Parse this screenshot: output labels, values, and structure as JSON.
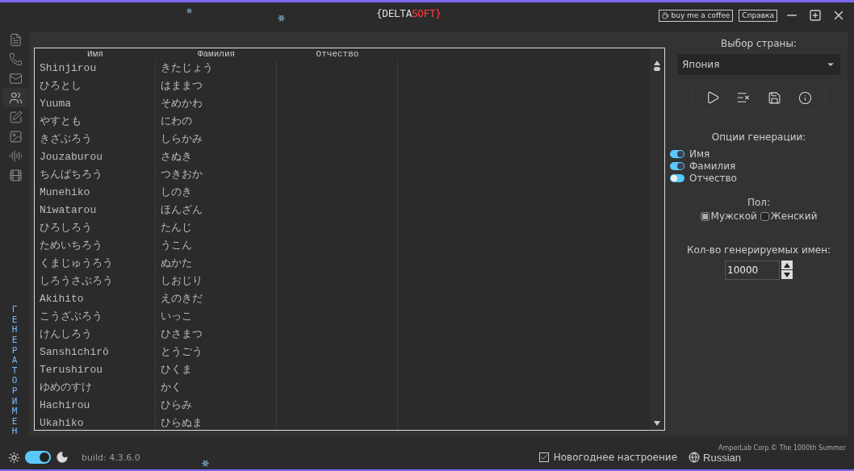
{
  "title_bar": {
    "logo": {
      "left": "{DELTA",
      "right": "SOFT}"
    },
    "buttons": [
      "buy me a coffee",
      "Справка"
    ]
  },
  "sidebar": {
    "items": [
      {
        "kind": "document",
        "selected": false
      },
      {
        "kind": "phone",
        "selected": false
      },
      {
        "kind": "mail",
        "selected": false
      },
      {
        "kind": "people",
        "selected": true
      },
      {
        "kind": "edit",
        "selected": false
      },
      {
        "kind": "image",
        "selected": false
      },
      {
        "kind": "audio",
        "selected": false
      },
      {
        "kind": "film",
        "selected": false
      }
    ],
    "section_title": "ГЕНЕРАТОР ИМЕН"
  },
  "table": {
    "columns": [
      "Имя",
      "Фамилия",
      "Отчество"
    ],
    "rows": [
      [
        "Shinjirou",
        "きたじょう",
        ""
      ],
      [
        "ひろとし",
        "はままつ",
        ""
      ],
      [
        "Yuuma",
        "そめかわ",
        ""
      ],
      [
        "やすとも",
        "にわの",
        ""
      ],
      [
        "きざぶろう",
        "しらかみ",
        ""
      ],
      [
        "Jouzaburou",
        "さぬき",
        ""
      ],
      [
        "ちんぱちろう",
        "つきおか",
        ""
      ],
      [
        "Munehiko",
        "しのき",
        ""
      ],
      [
        "Niwatarou",
        "ほんざん",
        ""
      ],
      [
        "ひろしろう",
        "たんじ",
        ""
      ],
      [
        "ためいちろう",
        "うこん",
        ""
      ],
      [
        "くまじゅうろう",
        "ぬかた",
        ""
      ],
      [
        "しろうさぶろう",
        "しおじり",
        ""
      ],
      [
        "Akihito",
        "えのきだ",
        ""
      ],
      [
        "こうざぶろう",
        "いっこ",
        ""
      ],
      [
        "けんしろう",
        "ひさまつ",
        ""
      ],
      [
        "Sanshichirō",
        "とうごう",
        ""
      ],
      [
        "Terushirou",
        "ひくま",
        ""
      ],
      [
        "ゆめのすけ",
        "かく",
        ""
      ],
      [
        "Hachirou",
        "ひらみ",
        ""
      ],
      [
        "Ukahiko",
        "ひらぬま",
        ""
      ]
    ]
  },
  "settings": {
    "country_label": "Выбор страны:",
    "country": "Япония",
    "options_label": "Опции генерации:",
    "options": [
      {
        "label": "Имя",
        "on": true
      },
      {
        "label": "Фамилия",
        "on": true
      },
      {
        "label": "Отчество",
        "on": false
      }
    ],
    "gender_label": "Пол:",
    "genders": [
      {
        "label": "Мужской",
        "selected": true
      },
      {
        "label": "Женский",
        "selected": false
      }
    ],
    "count_label": "Кол-во генерируемых имен:",
    "count": "10000"
  },
  "status_bar": {
    "dark_theme": true,
    "build": "build: 4.3.6.0",
    "new_year_mood": {
      "label": "Новогоднее настроение",
      "checked": true
    },
    "language": "Russian",
    "copyright": "AmperLab Corp.© The 1000th Summer"
  }
}
